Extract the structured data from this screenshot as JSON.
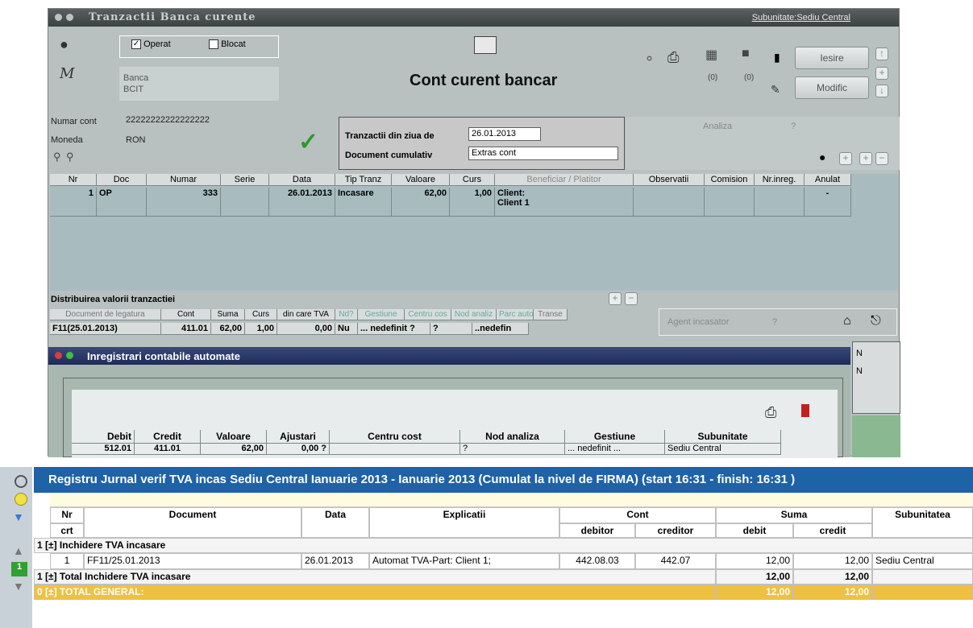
{
  "window": {
    "title": "Tranzactii Banca curente",
    "subunitate": "Subunitate:Sediu Central"
  },
  "top": {
    "operat": "Operat",
    "blocat": "Blocat",
    "banca_label": "Banca",
    "banca_value": "BCIT",
    "heading": "Cont curent bancar",
    "count1": "(0)",
    "count2": "(0)",
    "iesire": "Iesire",
    "modific": "Modific"
  },
  "account": {
    "numar_label": "Numar cont",
    "numar_value": "22222222222222222",
    "moneda_label": "Moneda",
    "moneda_value": "RON",
    "tranz_label": "Tranzactii din ziua de",
    "tranz_value": "26.01.2013",
    "doc_label": "Document cumulativ",
    "doc_value": "Extras cont",
    "analiza": "Analiza",
    "q": "?"
  },
  "grid": {
    "headers": [
      "Nr",
      "Doc",
      "Numar",
      "Serie",
      "Data",
      "Tip Tranz",
      "Valoare",
      "Curs",
      "Beneficiar / Platitor",
      "Observatii",
      "Comision",
      "Nr.inreg.",
      "Anulat"
    ],
    "row": [
      "1",
      "OP",
      "333",
      "",
      "26.01.2013",
      "Incasare",
      "62,00",
      "1,00",
      "Client:",
      "",
      "",
      "",
      "-"
    ],
    "row_extra": "Client 1"
  },
  "distrib": {
    "title": "Distribuirea valorii tranzactiei",
    "headers": [
      "Document de legatura",
      "Cont",
      "Suma",
      "Curs",
      "din care TVA",
      "Nd?",
      "Gestiune",
      "Centru cos",
      "Nod analiz",
      "Parc auto",
      "Transe"
    ],
    "row": [
      "F11(25.01.2013)",
      "411.01",
      "62,00",
      "1,00",
      "0,00",
      "Nu",
      "... nedefinit ?",
      "?",
      "..nedefin",
      "",
      ""
    ],
    "agent": "Agent incasator",
    "agent_q": "?"
  },
  "inreg": {
    "title": "Inregistrari contabile automate",
    "headers": [
      "Debit",
      "Credit",
      "Valoare",
      "Ajustari",
      "Centru cost",
      "Nod analiza",
      "Gestiune",
      "Subunitate"
    ],
    "row": [
      "512.01",
      "411.01",
      "62,00",
      "0,00 ?",
      "",
      "?",
      "... nedefinit ...",
      "Sediu Central"
    ],
    "side1": "N",
    "side2": "N"
  },
  "report": {
    "title": "Registru Jurnal verif TVA incas  Sediu Central Ianuarie 2013 - Ianuarie 2013 (Cumulat la nivel de FIRMA) (start 16:31 - finish:  16:31 )",
    "h_nr": "Nr",
    "h_crt": "crt",
    "h_document": "Document",
    "h_data": "Data",
    "h_explicatii": "Explicatii",
    "h_cont": "Cont",
    "h_debitor": "debitor",
    "h_creditor": "creditor",
    "h_suma": "Suma",
    "h_debit": "debit",
    "h_credit": "credit",
    "h_subunitatea": "Subunitatea",
    "group": "1 [±] Inchidere TVA incasare",
    "row": {
      "nr": "1",
      "document": "FF11/25.01.2013",
      "data": "26.01.2013",
      "explicatii": "Automat TVA-Part: Client 1;",
      "debitor": "442.08.03",
      "creditor": "442.07",
      "debit": "12,00",
      "credit": "12,00",
      "subunitate": "Sediu Central"
    },
    "total": {
      "label": "1 [±] Total Inchidere TVA incasare",
      "debit": "12,00",
      "credit": "12,00"
    },
    "general": {
      "label": "0 [±] TOTAL GENERAL:",
      "debit": "12,00",
      "credit": "12,00"
    },
    "side_num": "1"
  }
}
